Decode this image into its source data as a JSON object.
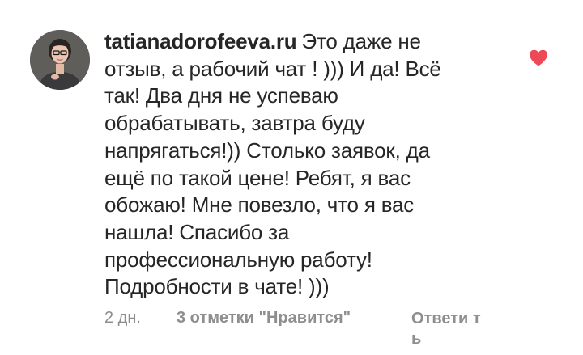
{
  "comment": {
    "username": "tatianadorofeeva.ru",
    "text": "Это даже не отзыв, а рабочий чат ! ))) И да! Всё так! Два дня не успеваю обрабатывать, завтра буду напрягаться!)) Столько заявок, да ещё по такой цене! Ребят, я вас обожаю! Мне повезло, что я вас нашла! Спасибо за профессиональную работу! Подробности в чате! )))",
    "timestamp": "2 дн.",
    "likes_label": "3 отметки \"Нравится\"",
    "reply_label": "Ответи ть",
    "like_icon": "heart-icon",
    "colors": {
      "text": "#262626",
      "meta": "#8e8e8e",
      "heart": "#ed4956"
    }
  }
}
